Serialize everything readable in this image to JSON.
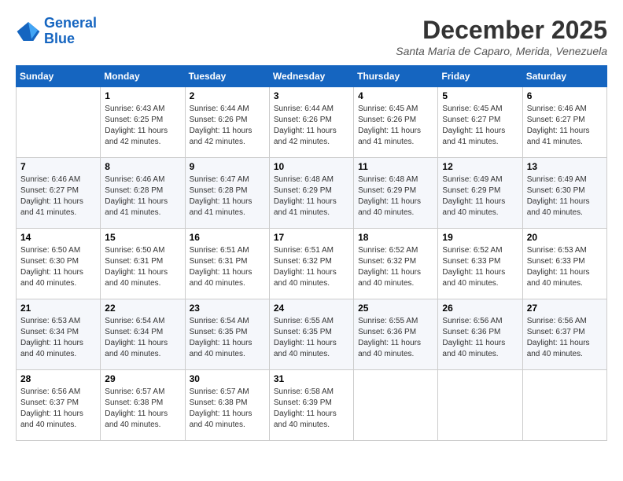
{
  "header": {
    "logo_line1": "General",
    "logo_line2": "Blue",
    "month_year": "December 2025",
    "location": "Santa Maria de Caparo, Merida, Venezuela"
  },
  "days_of_week": [
    "Sunday",
    "Monday",
    "Tuesday",
    "Wednesday",
    "Thursday",
    "Friday",
    "Saturday"
  ],
  "weeks": [
    [
      {
        "day": "",
        "sunrise": "",
        "sunset": "",
        "daylight": ""
      },
      {
        "day": "1",
        "sunrise": "Sunrise: 6:43 AM",
        "sunset": "Sunset: 6:25 PM",
        "daylight": "Daylight: 11 hours and 42 minutes."
      },
      {
        "day": "2",
        "sunrise": "Sunrise: 6:44 AM",
        "sunset": "Sunset: 6:26 PM",
        "daylight": "Daylight: 11 hours and 42 minutes."
      },
      {
        "day": "3",
        "sunrise": "Sunrise: 6:44 AM",
        "sunset": "Sunset: 6:26 PM",
        "daylight": "Daylight: 11 hours and 42 minutes."
      },
      {
        "day": "4",
        "sunrise": "Sunrise: 6:45 AM",
        "sunset": "Sunset: 6:26 PM",
        "daylight": "Daylight: 11 hours and 41 minutes."
      },
      {
        "day": "5",
        "sunrise": "Sunrise: 6:45 AM",
        "sunset": "Sunset: 6:27 PM",
        "daylight": "Daylight: 11 hours and 41 minutes."
      },
      {
        "day": "6",
        "sunrise": "Sunrise: 6:46 AM",
        "sunset": "Sunset: 6:27 PM",
        "daylight": "Daylight: 11 hours and 41 minutes."
      }
    ],
    [
      {
        "day": "7",
        "sunrise": "Sunrise: 6:46 AM",
        "sunset": "Sunset: 6:27 PM",
        "daylight": "Daylight: 11 hours and 41 minutes."
      },
      {
        "day": "8",
        "sunrise": "Sunrise: 6:46 AM",
        "sunset": "Sunset: 6:28 PM",
        "daylight": "Daylight: 11 hours and 41 minutes."
      },
      {
        "day": "9",
        "sunrise": "Sunrise: 6:47 AM",
        "sunset": "Sunset: 6:28 PM",
        "daylight": "Daylight: 11 hours and 41 minutes."
      },
      {
        "day": "10",
        "sunrise": "Sunrise: 6:48 AM",
        "sunset": "Sunset: 6:29 PM",
        "daylight": "Daylight: 11 hours and 41 minutes."
      },
      {
        "day": "11",
        "sunrise": "Sunrise: 6:48 AM",
        "sunset": "Sunset: 6:29 PM",
        "daylight": "Daylight: 11 hours and 40 minutes."
      },
      {
        "day": "12",
        "sunrise": "Sunrise: 6:49 AM",
        "sunset": "Sunset: 6:29 PM",
        "daylight": "Daylight: 11 hours and 40 minutes."
      },
      {
        "day": "13",
        "sunrise": "Sunrise: 6:49 AM",
        "sunset": "Sunset: 6:30 PM",
        "daylight": "Daylight: 11 hours and 40 minutes."
      }
    ],
    [
      {
        "day": "14",
        "sunrise": "Sunrise: 6:50 AM",
        "sunset": "Sunset: 6:30 PM",
        "daylight": "Daylight: 11 hours and 40 minutes."
      },
      {
        "day": "15",
        "sunrise": "Sunrise: 6:50 AM",
        "sunset": "Sunset: 6:31 PM",
        "daylight": "Daylight: 11 hours and 40 minutes."
      },
      {
        "day": "16",
        "sunrise": "Sunrise: 6:51 AM",
        "sunset": "Sunset: 6:31 PM",
        "daylight": "Daylight: 11 hours and 40 minutes."
      },
      {
        "day": "17",
        "sunrise": "Sunrise: 6:51 AM",
        "sunset": "Sunset: 6:32 PM",
        "daylight": "Daylight: 11 hours and 40 minutes."
      },
      {
        "day": "18",
        "sunrise": "Sunrise: 6:52 AM",
        "sunset": "Sunset: 6:32 PM",
        "daylight": "Daylight: 11 hours and 40 minutes."
      },
      {
        "day": "19",
        "sunrise": "Sunrise: 6:52 AM",
        "sunset": "Sunset: 6:33 PM",
        "daylight": "Daylight: 11 hours and 40 minutes."
      },
      {
        "day": "20",
        "sunrise": "Sunrise: 6:53 AM",
        "sunset": "Sunset: 6:33 PM",
        "daylight": "Daylight: 11 hours and 40 minutes."
      }
    ],
    [
      {
        "day": "21",
        "sunrise": "Sunrise: 6:53 AM",
        "sunset": "Sunset: 6:34 PM",
        "daylight": "Daylight: 11 hours and 40 minutes."
      },
      {
        "day": "22",
        "sunrise": "Sunrise: 6:54 AM",
        "sunset": "Sunset: 6:34 PM",
        "daylight": "Daylight: 11 hours and 40 minutes."
      },
      {
        "day": "23",
        "sunrise": "Sunrise: 6:54 AM",
        "sunset": "Sunset: 6:35 PM",
        "daylight": "Daylight: 11 hours and 40 minutes."
      },
      {
        "day": "24",
        "sunrise": "Sunrise: 6:55 AM",
        "sunset": "Sunset: 6:35 PM",
        "daylight": "Daylight: 11 hours and 40 minutes."
      },
      {
        "day": "25",
        "sunrise": "Sunrise: 6:55 AM",
        "sunset": "Sunset: 6:36 PM",
        "daylight": "Daylight: 11 hours and 40 minutes."
      },
      {
        "day": "26",
        "sunrise": "Sunrise: 6:56 AM",
        "sunset": "Sunset: 6:36 PM",
        "daylight": "Daylight: 11 hours and 40 minutes."
      },
      {
        "day": "27",
        "sunrise": "Sunrise: 6:56 AM",
        "sunset": "Sunset: 6:37 PM",
        "daylight": "Daylight: 11 hours and 40 minutes."
      }
    ],
    [
      {
        "day": "28",
        "sunrise": "Sunrise: 6:56 AM",
        "sunset": "Sunset: 6:37 PM",
        "daylight": "Daylight: 11 hours and 40 minutes."
      },
      {
        "day": "29",
        "sunrise": "Sunrise: 6:57 AM",
        "sunset": "Sunset: 6:38 PM",
        "daylight": "Daylight: 11 hours and 40 minutes."
      },
      {
        "day": "30",
        "sunrise": "Sunrise: 6:57 AM",
        "sunset": "Sunset: 6:38 PM",
        "daylight": "Daylight: 11 hours and 40 minutes."
      },
      {
        "day": "31",
        "sunrise": "Sunrise: 6:58 AM",
        "sunset": "Sunset: 6:39 PM",
        "daylight": "Daylight: 11 hours and 40 minutes."
      },
      {
        "day": "",
        "sunrise": "",
        "sunset": "",
        "daylight": ""
      },
      {
        "day": "",
        "sunrise": "",
        "sunset": "",
        "daylight": ""
      },
      {
        "day": "",
        "sunrise": "",
        "sunset": "",
        "daylight": ""
      }
    ]
  ]
}
